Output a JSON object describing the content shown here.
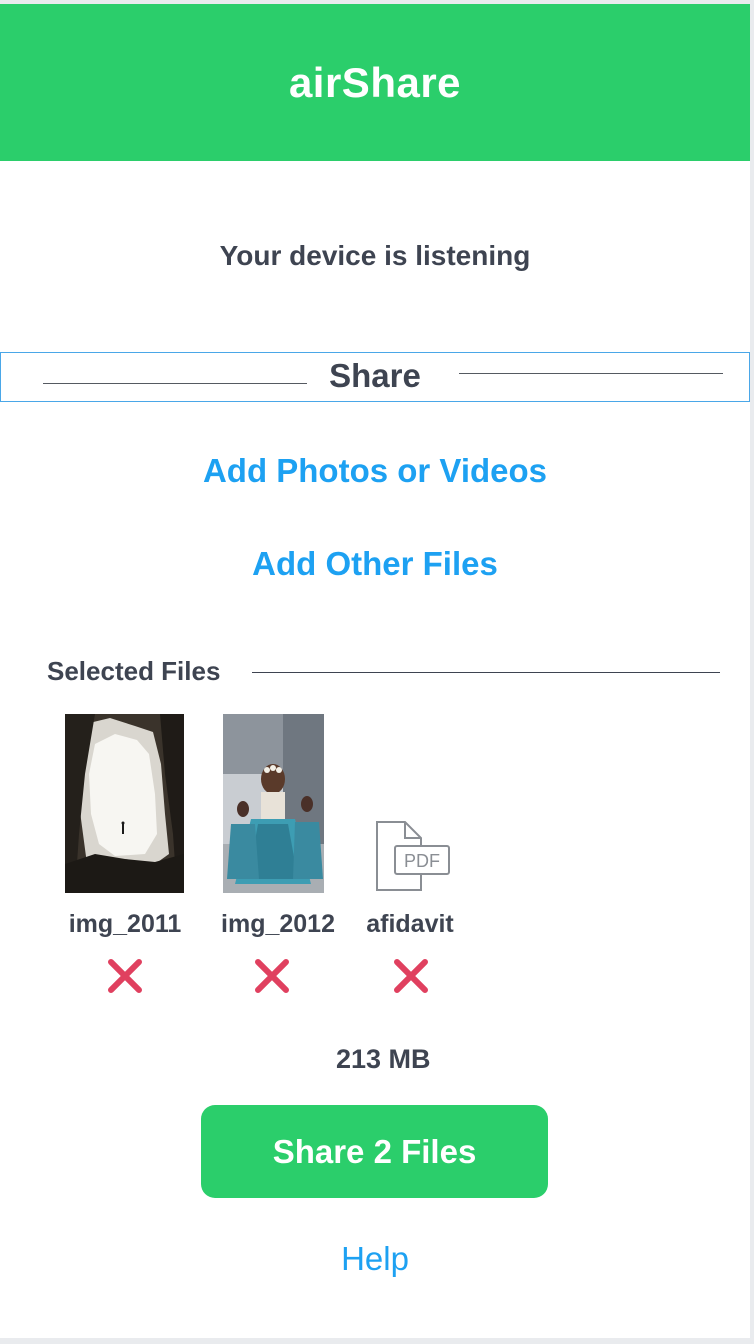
{
  "header": {
    "title": "airShare"
  },
  "status": {
    "text": "Your device is listening"
  },
  "share_section": {
    "label": "Share"
  },
  "actions": {
    "add_photos": "Add Photos or Videos",
    "add_other": "Add Other Files"
  },
  "selected": {
    "label": "Selected Files",
    "files": [
      {
        "name": "img_2011",
        "thumb_icon": "cave-photo-thumbnail",
        "remove_icon": "remove-x-icon"
      },
      {
        "name": "img_2012",
        "thumb_icon": "dancers-photo-thumbnail",
        "remove_icon": "remove-x-icon"
      },
      {
        "name": "afidavit",
        "thumb_icon": "pdf-file-icon",
        "thumb_text": "PDF",
        "remove_icon": "remove-x-icon"
      }
    ],
    "total_size": "213 MB"
  },
  "share_button": {
    "label": "Share 2 Files"
  },
  "help": {
    "label": "Help"
  },
  "colors": {
    "brand_green": "#2bce6b",
    "link_blue": "#1da1f2",
    "text_dark": "#3e4451",
    "remove_red": "#e0405f"
  }
}
